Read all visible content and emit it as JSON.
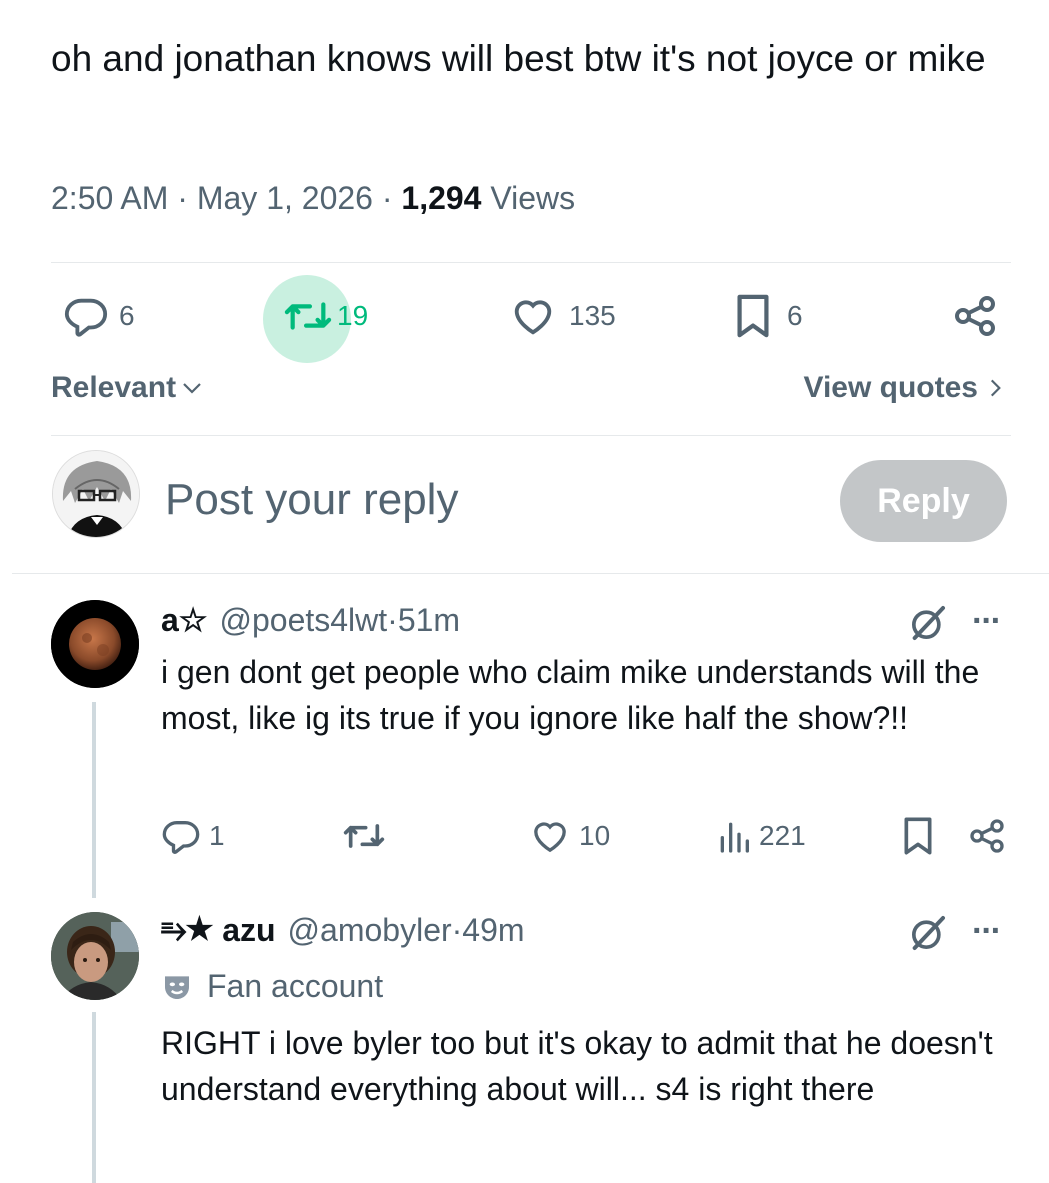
{
  "main_post": {
    "text": "oh and jonathan knows will best btw it's not joyce or mike",
    "time": "2:50 AM",
    "sep1": " · ",
    "date": "May 1, 2026",
    "sep2": " · ",
    "views_count": "1,294",
    "views_label": " Views",
    "stats": {
      "replies": "6",
      "reposts": "19",
      "likes": "135",
      "bookmarks": "6"
    },
    "accent_repost": "#00ba7c"
  },
  "sort": {
    "label": "Relevant",
    "view_quotes": "View quotes"
  },
  "compose": {
    "placeholder": "Post your reply",
    "reply_button": "Reply"
  },
  "replies": [
    {
      "name": "a☆",
      "handle": "@poets4lwt",
      "sep": " · ",
      "time": "51m",
      "text": "i gen dont get people who claim mike understands will the most, like ig its true if you ignore like half the show?!!",
      "stats": {
        "replies": "1",
        "reposts": "",
        "likes": "10",
        "views": "221"
      }
    },
    {
      "prefix": "⥱★",
      "name": "azu",
      "handle": "@amobyler",
      "sep": " · ",
      "time": "49m",
      "label": "Fan account",
      "text": "RIGHT i love byler too but it's okay to admit that he doesn't understand everything about will... s4 is right there"
    }
  ],
  "icons": {
    "reply": "reply-icon",
    "repost": "repost-icon",
    "like": "heart-icon",
    "bookmark": "bookmark-icon",
    "share": "share-icon",
    "views": "views-icon",
    "grok": "grok-icon",
    "more": "more-icon",
    "mask": "mask-icon"
  },
  "more_glyph": "···",
  "chevron_right": "›"
}
